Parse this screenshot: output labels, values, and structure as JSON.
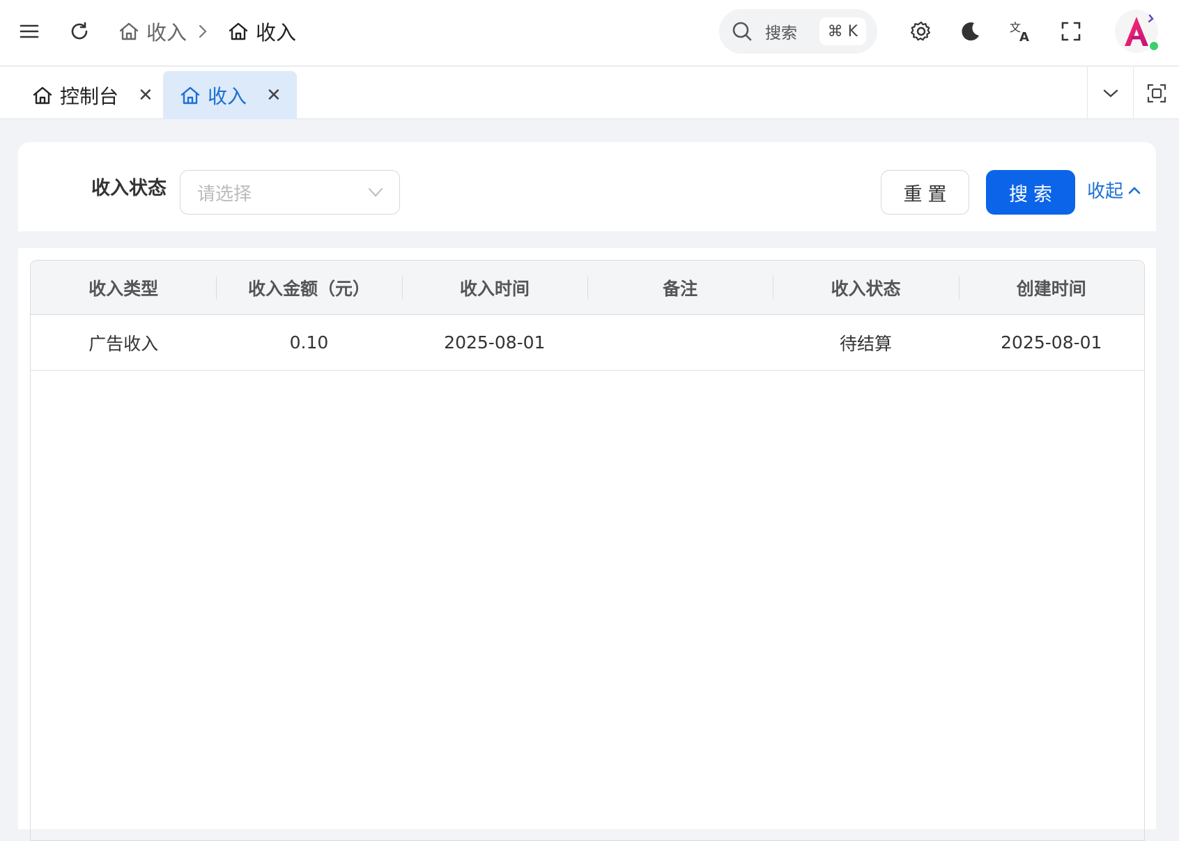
{
  "header": {
    "breadcrumb": [
      "收入",
      "收入"
    ],
    "search_label": "搜索",
    "search_shortcut": "⌘ K"
  },
  "tabs": [
    {
      "label": "控制台",
      "active": false
    },
    {
      "label": "收入",
      "active": true
    }
  ],
  "filter": {
    "label": "收入状态",
    "placeholder": "请选择",
    "reset_label": "重置",
    "search_label": "搜索",
    "collapse_label": "收起"
  },
  "table": {
    "columns": [
      "收入类型",
      "收入金额（元）",
      "收入时间",
      "备注",
      "收入状态",
      "创建时间"
    ],
    "rows": [
      [
        "广告收入",
        "0.10",
        "2025-08-01",
        "",
        "待结算",
        "2025-08-01"
      ]
    ]
  },
  "colors": {
    "accent": "#0c64e8",
    "active_tab_bg": "#ddeafa",
    "status_online": "#3ecf6b"
  }
}
